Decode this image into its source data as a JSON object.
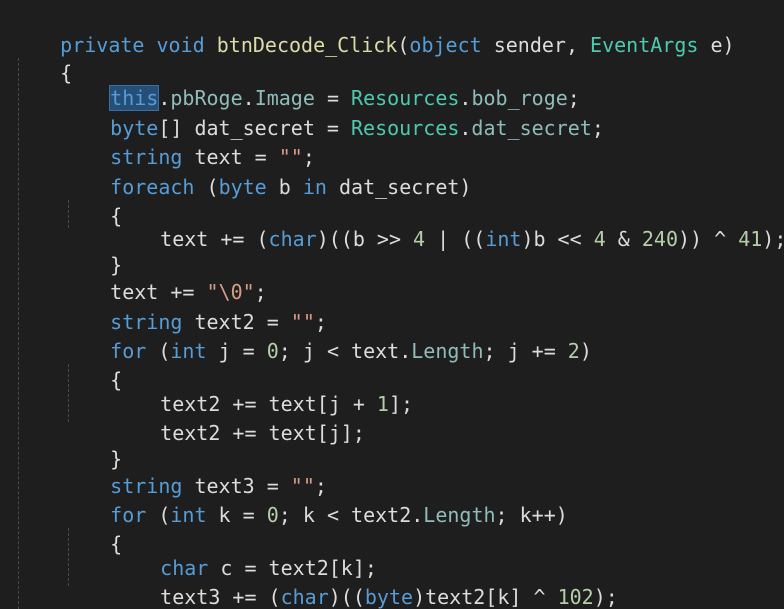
{
  "code": {
    "l1": {
      "a": "private",
      "b": " ",
      "c": "void",
      "d": " ",
      "e": "btnDecode_Click",
      "f": "(",
      "g": "object",
      "h": " sender, ",
      "i": "EventArgs",
      "j": " e)"
    },
    "l2": {
      "a": "{"
    },
    "l3": {
      "a": "this",
      "b": ".",
      "c": "pbRoge",
      "d": ".",
      "e": "Image",
      "f": " = ",
      "g": "Resources",
      "h": ".",
      "i": "bob_roge",
      "j": ";"
    },
    "l4": {
      "a": "byte",
      "b": "[] dat_secret = ",
      "c": "Resources",
      "d": ".",
      "e": "dat_secret",
      "f": ";"
    },
    "l5": {
      "a": "string",
      "b": " text = ",
      "c": "\"\"",
      "d": ";"
    },
    "l6": {
      "a": "foreach",
      "b": " (",
      "c": "byte",
      "d": " b ",
      "e": "in",
      "f": " dat_secret)"
    },
    "l7": {
      "a": "{"
    },
    "l8": {
      "a": "text += (",
      "b": "char",
      "c": ")((b >> ",
      "d": "4",
      "e": " | ((",
      "f": "int",
      "g": ")b << ",
      "h": "4",
      "i": " & ",
      "j": "240",
      "k": ")) ^ ",
      "l": "41",
      "m": ");"
    },
    "l9": {
      "a": "}"
    },
    "l10": {
      "a": "text += ",
      "b": "\"\\0\"",
      "c": ";"
    },
    "l11": {
      "a": "string",
      "b": " text2 = ",
      "c": "\"\"",
      "d": ";"
    },
    "l12": {
      "a": "for",
      "b": " (",
      "c": "int",
      "d": " j = ",
      "e": "0",
      "f": "; j < text.",
      "g": "Length",
      "h": "; j += ",
      "i": "2",
      "j": ")"
    },
    "l13": {
      "a": "{"
    },
    "l14": {
      "a": "text2 += text[j + ",
      "b": "1",
      "c": "];"
    },
    "l15": {
      "a": "text2 += text[j];"
    },
    "l16": {
      "a": "}"
    },
    "l17": {
      "a": "string",
      "b": " text3 = ",
      "c": "\"\"",
      "d": ";"
    },
    "l18": {
      "a": "for",
      "b": " (",
      "c": "int",
      "d": " k = ",
      "e": "0",
      "f": "; k < text2.",
      "g": "Length",
      "h": "; k++)"
    },
    "l19": {
      "a": "{"
    },
    "l20": {
      "a": "char",
      "b": " c = text2[k];"
    },
    "l21": {
      "a": "text3 += (",
      "b": "char",
      "c": ")((",
      "d": "byte",
      "e": ")text2[k] ^ ",
      "f": "102",
      "g": ");"
    },
    "l22": {
      "a": "}"
    }
  },
  "colors": {
    "background": "#1e1e1e",
    "keyword": "#569cd6",
    "type": "#4ec9b0",
    "method": "#dcdcaa",
    "string": "#d69d85",
    "number": "#b5cea8",
    "identifier": "#dcdcdc",
    "selection": "#264f78"
  }
}
